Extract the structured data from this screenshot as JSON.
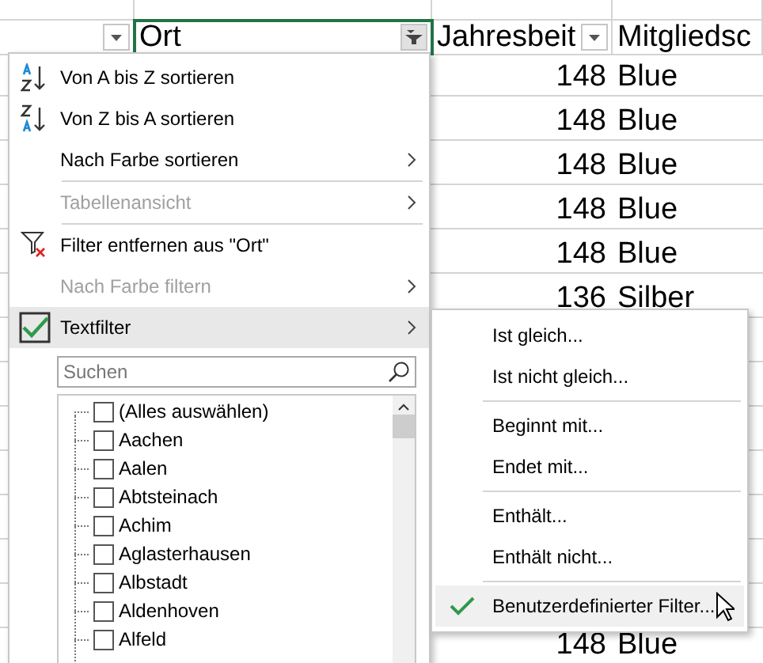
{
  "sheet": {
    "headers": [
      {
        "kind": "plain",
        "selected": false
      },
      {
        "label": "Ort",
        "kind": "filter",
        "selected": true
      },
      {
        "label": "Jahresbeit",
        "kind": "plain",
        "selected": false
      },
      {
        "label": "Mitgliedsc",
        "kind": "none",
        "selected": false
      }
    ],
    "rows": [
      {
        "amount": "148",
        "level": "Blue",
        "kind": "top"
      },
      {
        "amount": "148",
        "level": "Blue",
        "kind": "top"
      },
      {
        "amount": "148",
        "level": "Blue",
        "kind": "top"
      },
      {
        "amount": "148",
        "level": "Blue",
        "kind": "top"
      },
      {
        "amount": "148",
        "level": "Blue",
        "kind": "top"
      },
      {
        "amount": "136",
        "level": "Silber",
        "kind": "top"
      },
      {
        "amount": "148",
        "level": "Blue",
        "kind": "bottom"
      }
    ]
  },
  "filter_menu": {
    "items": [
      {
        "kind": "sort_az",
        "label": "Von A bis Z sortieren",
        "disabled": false,
        "submenu": false
      },
      {
        "kind": "sort_za",
        "label": "Von Z bis A sortieren",
        "disabled": false,
        "submenu": false
      },
      {
        "kind": "plain",
        "label": "Nach Farbe sortieren",
        "disabled": false,
        "submenu": true
      },
      {
        "kind": "separator"
      },
      {
        "kind": "plain",
        "label": "Tabellenansicht",
        "disabled": true,
        "submenu": true
      },
      {
        "kind": "separator"
      },
      {
        "kind": "clear_filter",
        "label": "Filter entfernen aus \"Ort\"",
        "disabled": false,
        "submenu": false
      },
      {
        "kind": "plain",
        "label": "Nach Farbe filtern",
        "disabled": true,
        "submenu": true
      },
      {
        "kind": "checked",
        "label": "Textfilter",
        "disabled": false,
        "submenu": true,
        "highlighted": true
      }
    ],
    "search": {
      "placeholder": "Suchen"
    },
    "values": [
      {
        "label": "(Alles auswählen)",
        "checked": false
      },
      {
        "label": "Aachen",
        "checked": false
      },
      {
        "label": "Aalen",
        "checked": false
      },
      {
        "label": "Abtsteinach",
        "checked": false
      },
      {
        "label": "Achim",
        "checked": false
      },
      {
        "label": "Aglasterhausen",
        "checked": false
      },
      {
        "label": "Albstadt",
        "checked": false
      },
      {
        "label": "Aldenhoven",
        "checked": false
      },
      {
        "label": "Alfeld",
        "checked": false
      }
    ]
  },
  "text_filter_menu": {
    "items": [
      {
        "kind": "item",
        "label": "Ist gleich...",
        "checked": false,
        "selected": false
      },
      {
        "kind": "item",
        "label": "Ist nicht gleich...",
        "checked": false,
        "selected": false
      },
      {
        "kind": "separator"
      },
      {
        "kind": "item",
        "label": "Beginnt mit...",
        "checked": false,
        "selected": false
      },
      {
        "kind": "item",
        "label": "Endet mit...",
        "checked": false,
        "selected": false
      },
      {
        "kind": "separator"
      },
      {
        "kind": "item",
        "label": "Enthält...",
        "checked": false,
        "selected": false
      },
      {
        "kind": "item",
        "label": "Enthält nicht...",
        "checked": false,
        "selected": false
      },
      {
        "kind": "separator"
      },
      {
        "kind": "item",
        "label": "Benutzerdefinierter Filter...",
        "checked": true,
        "selected": true
      }
    ]
  }
}
